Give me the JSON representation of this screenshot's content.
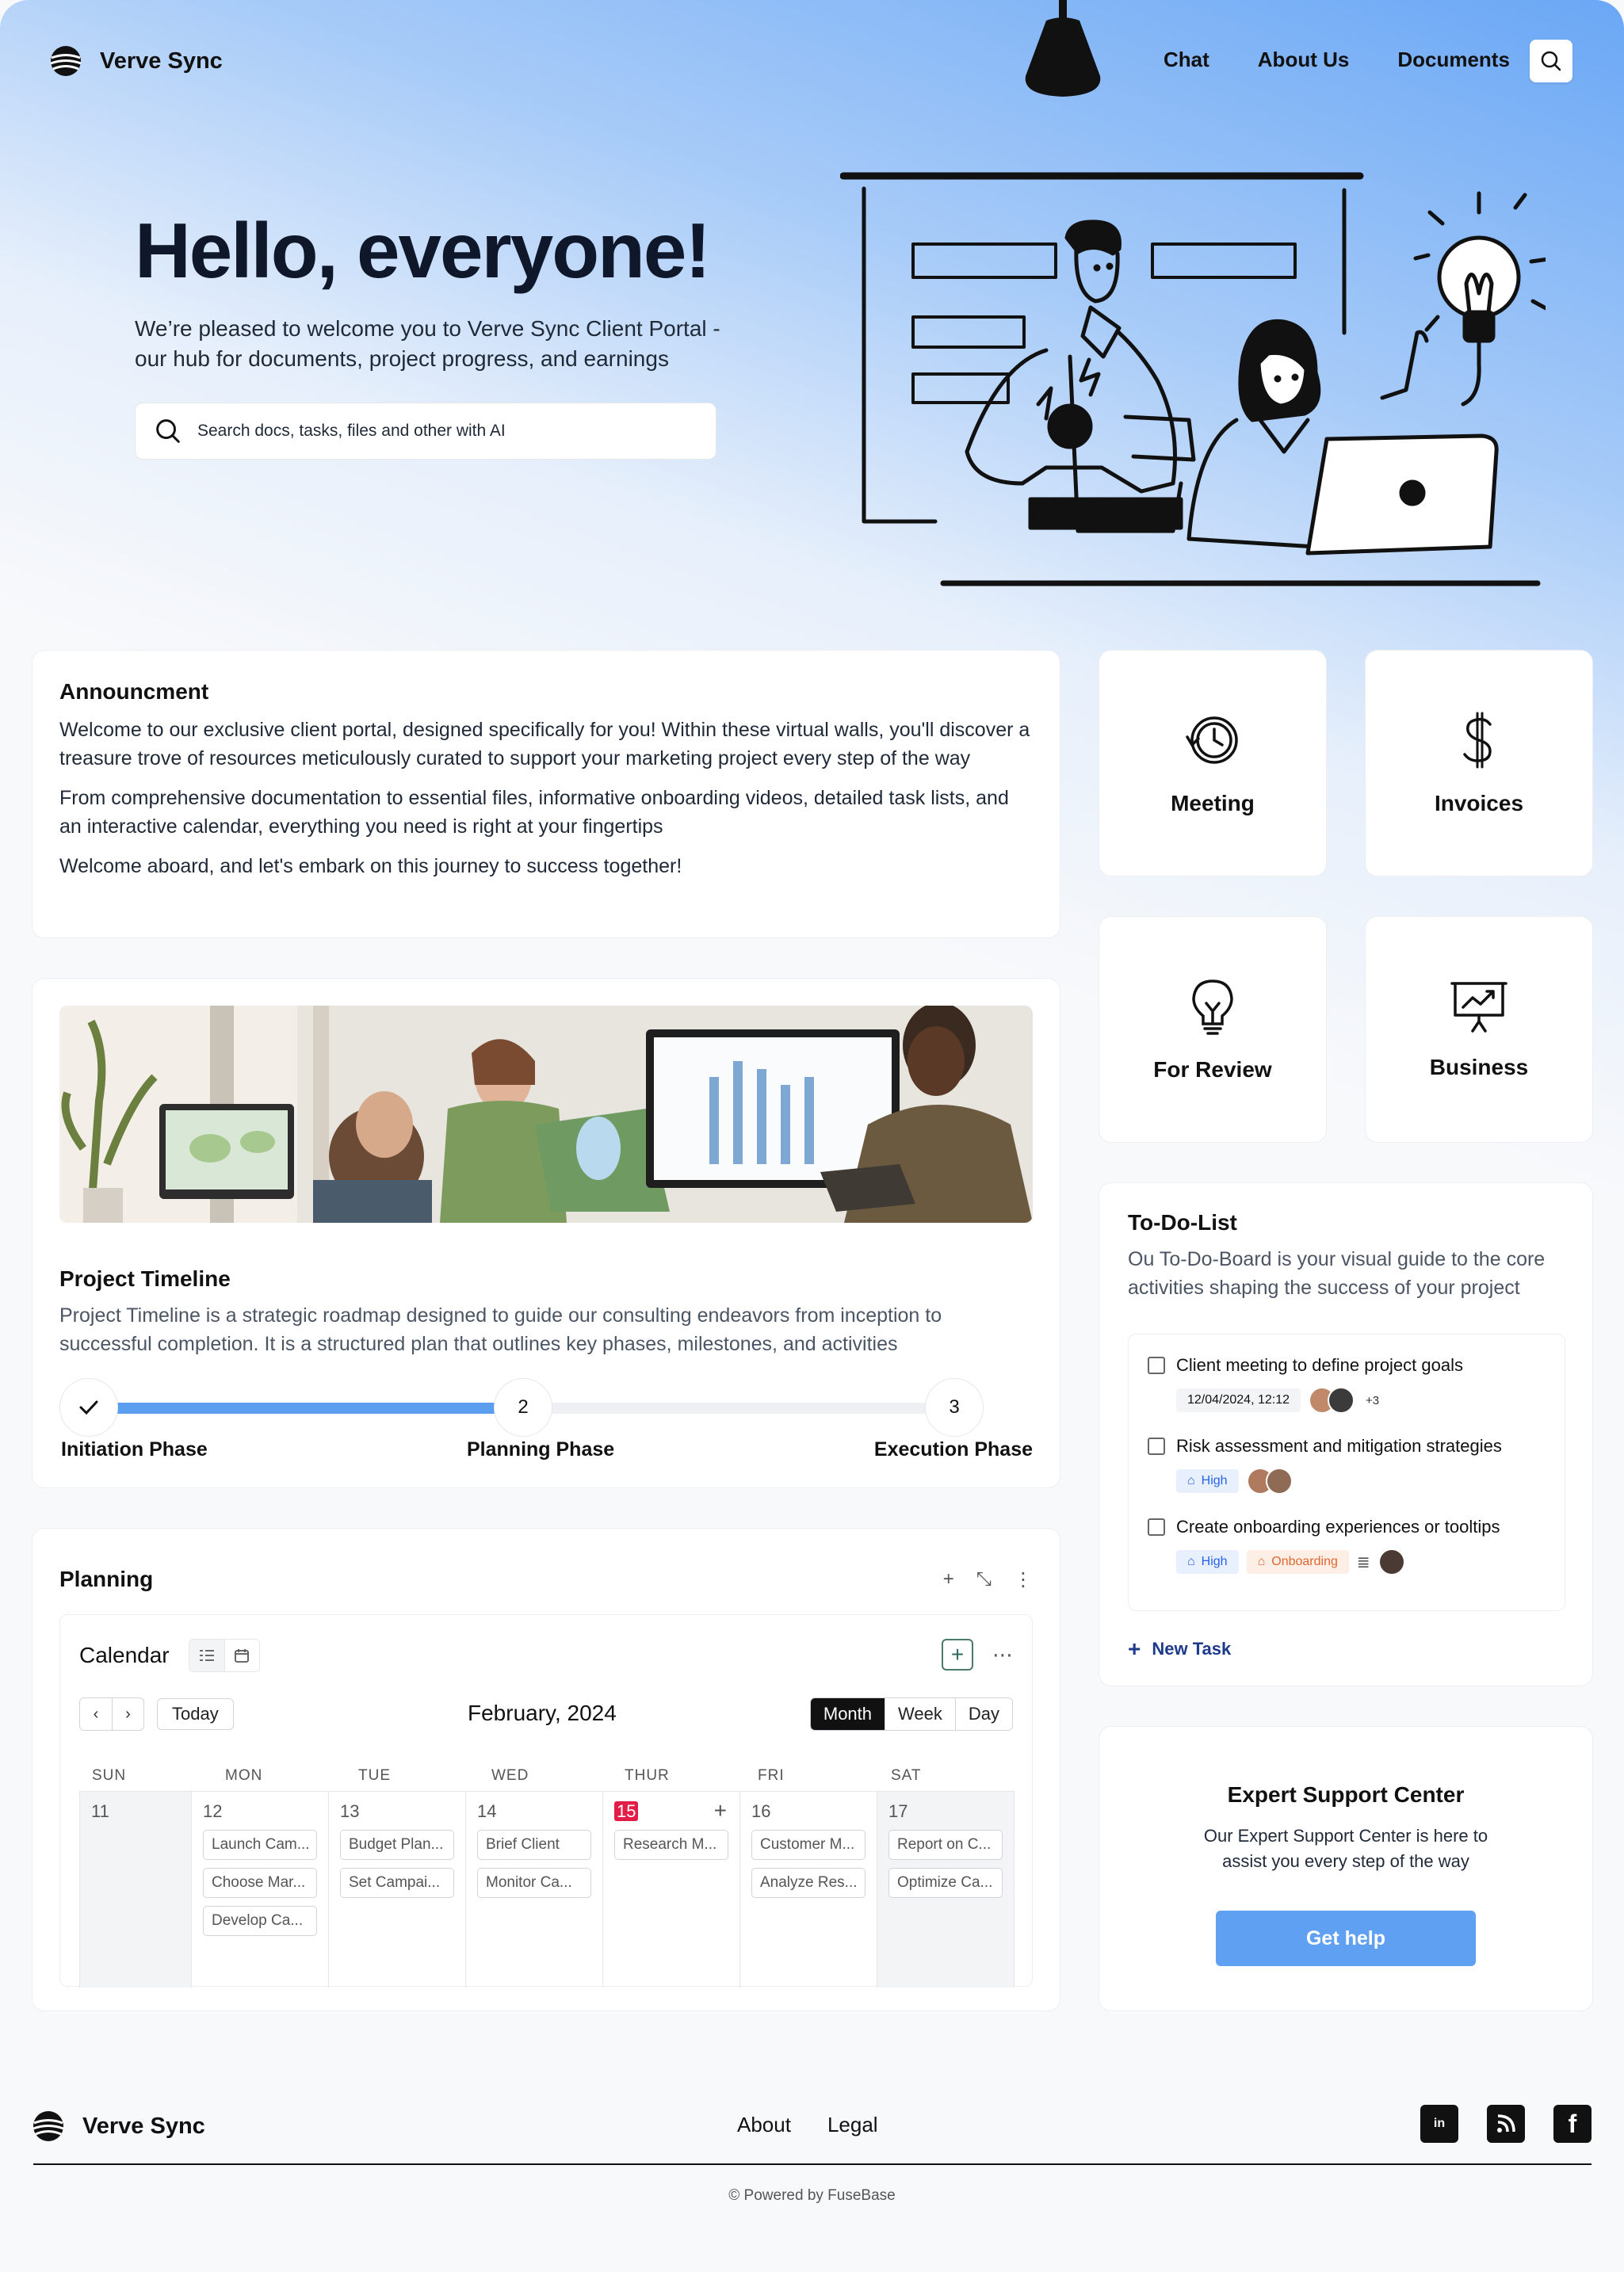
{
  "header": {
    "brand": "Verve Sync",
    "nav": [
      "Chat",
      "About Us",
      "Documents"
    ],
    "search_icon": "search-icon"
  },
  "hero": {
    "title": "Hello, everyone!",
    "subtitle": "We’re pleased to welcome you to Verve Sync Client Portal - our hub for documents, project progress, and earnings",
    "search_placeholder": "Search docs, tasks, files and other with AI"
  },
  "announcement": {
    "title": "Announcment",
    "paragraphs": [
      "Welcome to our exclusive client portal, designed specifically for you! Within these virtual walls, you'll discover a treasure trove of resources meticulously curated to support your marketing project every step of the way",
      "From comprehensive documentation to essential files, informative onboarding videos, detailed task lists, and an interactive calendar, everything you need is right at your fingertips",
      "Welcome aboard, and let's embark on this journey to success together!"
    ]
  },
  "project": {
    "title": "Project Timeline",
    "description": "Project Timeline is a strategic roadmap designed to guide our consulting endeavors from inception to successful completion. It is a structured plan that outlines key phases, milestones, and activities",
    "progress": 0.5,
    "steps": [
      "✓",
      "2",
      "3"
    ],
    "phases": [
      "Initiation Phase",
      "Planning Phase",
      "Execution Phase"
    ]
  },
  "planning": {
    "title": "Planning",
    "calendar_title": "Calendar",
    "today": "Today",
    "month": "February, 2024",
    "views": [
      "Month",
      "Week",
      "Day"
    ],
    "active_view": "Month",
    "days": [
      {
        "dow": "SUN",
        "num": "11",
        "events": []
      },
      {
        "dow": "MON",
        "num": "12",
        "events": [
          "Launch Cam...",
          "Choose Mar...",
          "Develop Ca..."
        ]
      },
      {
        "dow": "TUE",
        "num": "13",
        "events": [
          "Budget Plan...",
          "Set Campai..."
        ]
      },
      {
        "dow": "WED",
        "num": "14",
        "events": [
          "Brief Client",
          "Monitor Ca..."
        ]
      },
      {
        "dow": "THUR",
        "num": "15",
        "events": [
          "Research M..."
        ]
      },
      {
        "dow": "FRI",
        "num": "16",
        "events": [
          "Customer M...",
          "Analyze Res..."
        ]
      },
      {
        "dow": "SAT",
        "num": "17",
        "events": [
          "Report on C...",
          "Optimize Ca..."
        ]
      }
    ]
  },
  "tiles": [
    {
      "label": "Meeting",
      "icon": "clock-icon"
    },
    {
      "label": "Invoices",
      "icon": "dollar-icon"
    },
    {
      "label": "For Review",
      "icon": "lightbulb-icon"
    },
    {
      "label": "Business",
      "icon": "presentation-icon"
    }
  ],
  "todo": {
    "title": "To-Do-List",
    "description": "Ou To-Do-Board is your visual guide to the core activities shaping the success of your project",
    "tasks": [
      {
        "text": "Client meeting to define project goals",
        "date": "12/04/2024, 12:12",
        "extra": "+3"
      },
      {
        "text": "Risk assessment and mitigation strategies",
        "priority": "High"
      },
      {
        "text": "Create onboarding experiences or tooltips",
        "priority": "High",
        "tag": "Onboarding"
      }
    ],
    "new_task": "New Task"
  },
  "support": {
    "title": "Expert Support Center",
    "description": "Our Expert Support Center is here to assist you every step of the way",
    "button": "Get help"
  },
  "footer": {
    "brand": "Verve Sync",
    "links": [
      "About",
      "Legal"
    ],
    "social": [
      "linkedin-icon",
      "rss-icon",
      "facebook-icon"
    ],
    "powered": "Powered by FuseBase"
  },
  "colors": {
    "accent": "#5fa0f2",
    "progress": "#5b9ef0",
    "today": "#e11d48",
    "high_tag": "#2563eb",
    "onboarding_tag": "#e0662f"
  }
}
